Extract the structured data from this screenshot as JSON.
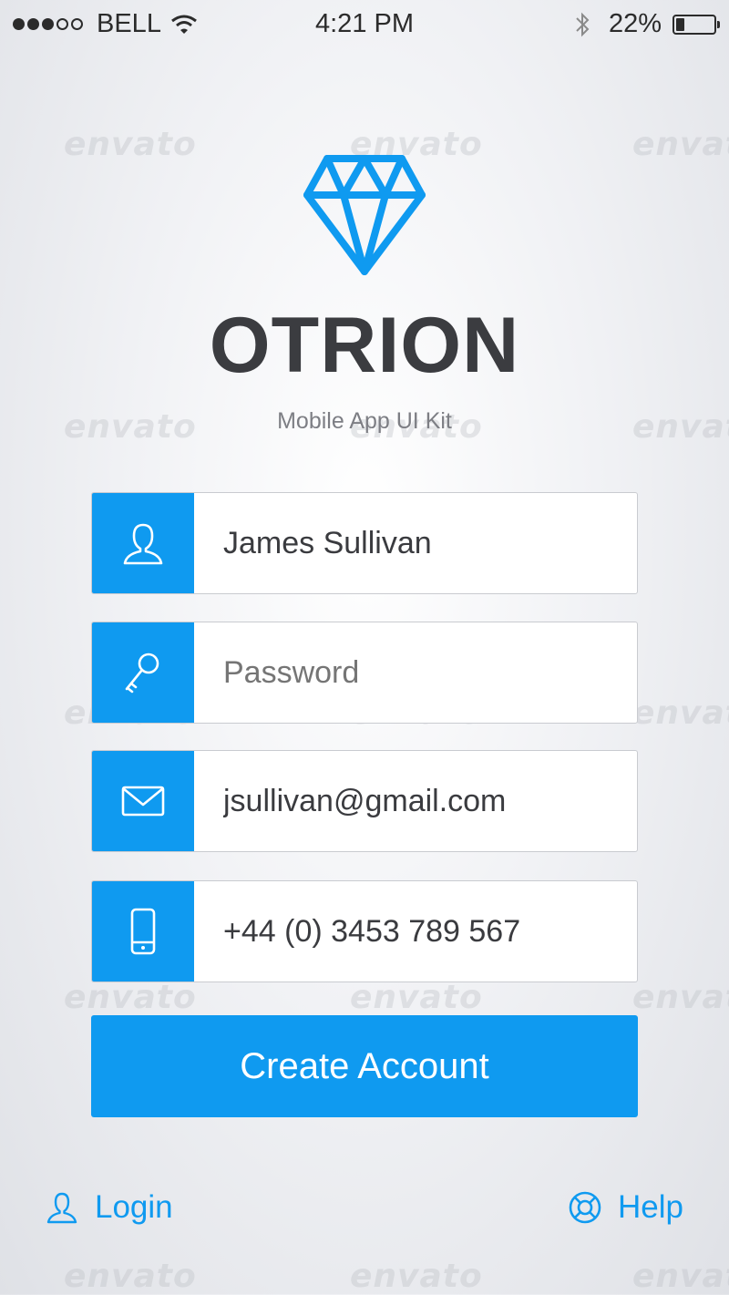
{
  "status_bar": {
    "carrier": "BELL",
    "time": "4:21 PM",
    "battery": "22%",
    "battery_level": 0.22
  },
  "watermark": "envato",
  "brand": {
    "name": "OTRION",
    "subtitle": "Mobile App UI Kit",
    "accent_color": "#0f9af0"
  },
  "form": {
    "name_value": "James Sullivan",
    "password_placeholder": "Password",
    "email_value": "jsullivan@gmail.com",
    "phone_value": "+44 (0) 3453 789 567",
    "submit_label": "Create Account"
  },
  "footer": {
    "login_label": "Login",
    "help_label": "Help"
  },
  "icons": {
    "name_field": "user-icon",
    "password_field": "key-icon",
    "email_field": "envelope-icon",
    "phone_field": "phone-icon",
    "login": "user-icon",
    "help": "lifebuoy-icon"
  }
}
